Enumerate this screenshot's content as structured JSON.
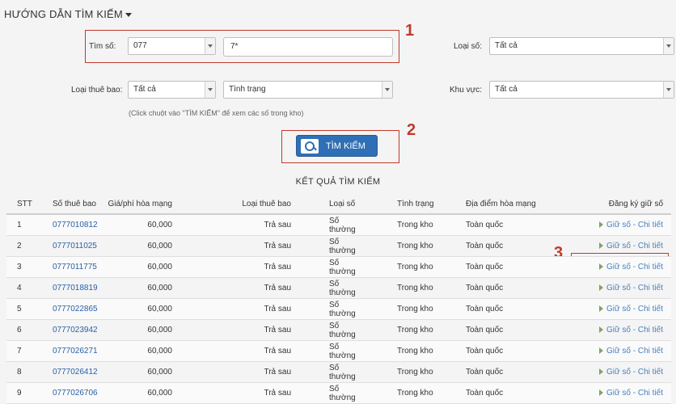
{
  "header": {
    "title": "HƯỚNG DẪN TÌM KIẾM"
  },
  "form": {
    "tim_so_label": "Tìm số:",
    "prefix_value": "077",
    "pattern_value": "7*",
    "loai_so_label": "Loại số:",
    "loai_so_value": "Tất cả",
    "loai_thue_bao_label": "Loại thuê bao:",
    "loai_thue_bao_value": "Tất cả",
    "tinh_trang_value": "Tình trạng",
    "khu_vuc_label": "Khu vực:",
    "khu_vuc_value": "Tất cả",
    "hint": "(Click chuột vào \"TÌM KIẾM\" để xem các số trong kho)",
    "search_button": "TÌM KIẾM"
  },
  "annotations": {
    "one": "1",
    "two": "2",
    "three": "3"
  },
  "results": {
    "title": "KẾT QUẢ TÌM KIẾM",
    "headers": [
      "STT",
      "Số thuê bao",
      "Giá/phí hòa mạng",
      "Loại thuê bao",
      "Loại số",
      "Tình trạng",
      "Địa điểm hòa mạng",
      "Đăng ký giữ số"
    ],
    "rows": [
      {
        "stt": "1",
        "number": "0777010812",
        "fee": "60,000",
        "type": "Trả sau",
        "kind": "Số thường",
        "status": "Trong kho",
        "area": "Toàn quốc",
        "action": "Giữ số - Chi tiết"
      },
      {
        "stt": "2",
        "number": "0777011025",
        "fee": "60,000",
        "type": "Trả sau",
        "kind": "Số thường",
        "status": "Trong kho",
        "area": "Toàn quốc",
        "action": "Giữ số - Chi tiết"
      },
      {
        "stt": "3",
        "number": "0777011775",
        "fee": "60,000",
        "type": "Trả sau",
        "kind": "Số thường",
        "status": "Trong kho",
        "area": "Toàn quốc",
        "action": "Giữ số - Chi tiết"
      },
      {
        "stt": "4",
        "number": "0777018819",
        "fee": "60,000",
        "type": "Trả sau",
        "kind": "Số thường",
        "status": "Trong kho",
        "area": "Toàn quốc",
        "action": "Giữ số - Chi tiết"
      },
      {
        "stt": "5",
        "number": "0777022865",
        "fee": "60,000",
        "type": "Trả sau",
        "kind": "Số thường",
        "status": "Trong kho",
        "area": "Toàn quốc",
        "action": "Giữ số - Chi tiết"
      },
      {
        "stt": "6",
        "number": "0777023942",
        "fee": "60,000",
        "type": "Trả sau",
        "kind": "Số thường",
        "status": "Trong kho",
        "area": "Toàn quốc",
        "action": "Giữ số - Chi tiết"
      },
      {
        "stt": "7",
        "number": "0777026271",
        "fee": "60,000",
        "type": "Trả sau",
        "kind": "Số thường",
        "status": "Trong kho",
        "area": "Toàn quốc",
        "action": "Giữ số - Chi tiết"
      },
      {
        "stt": "8",
        "number": "0777026412",
        "fee": "60,000",
        "type": "Trả sau",
        "kind": "Số thường",
        "status": "Trong kho",
        "area": "Toàn quốc",
        "action": "Giữ số - Chi tiết"
      },
      {
        "stt": "9",
        "number": "0777026706",
        "fee": "60,000",
        "type": "Trả sau",
        "kind": "Số thường",
        "status": "Trong kho",
        "area": "Toàn quốc",
        "action": "Giữ số - Chi tiết"
      }
    ]
  },
  "colors": {
    "annotation_red": "#c0392b",
    "button_blue": "#2f6fb5",
    "link_blue": "#2a5fa8",
    "arrow_green": "#7fa65c"
  }
}
